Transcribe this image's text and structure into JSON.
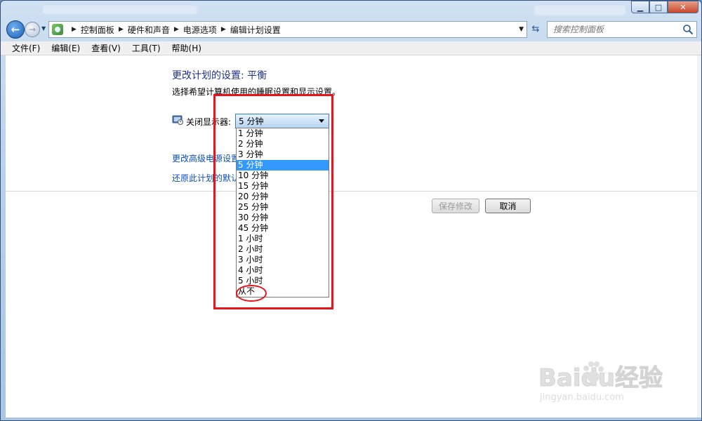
{
  "address_bar": {
    "crumbs": [
      "控制面板",
      "硬件和声音",
      "电源选项",
      "编辑计划设置"
    ]
  },
  "search": {
    "placeholder": "搜索控制面板"
  },
  "menu": [
    "文件(F)",
    "编辑(E)",
    "查看(V)",
    "工具(T)",
    "帮助(H)"
  ],
  "page": {
    "title": "更改计划的设置: 平衡",
    "description": "选择希望计算机使用的睡眠设置和显示设置。",
    "display_label": "关闭显示器:",
    "display_value": "5 分钟",
    "advanced_link": "更改高级电源设置(C)",
    "restore_link": "还原此计划的默认设置"
  },
  "dropdown": {
    "options": [
      "1 分钟",
      "2 分钟",
      "3 分钟",
      "5 分钟",
      "10 分钟",
      "15 分钟",
      "20 分钟",
      "25 分钟",
      "30 分钟",
      "45 分钟",
      "1 小时",
      "2 小时",
      "3 小时",
      "4 小时",
      "5 小时",
      "从不"
    ],
    "selected_index": 3
  },
  "buttons": {
    "save": "保存修改",
    "cancel": "取消"
  },
  "watermark": {
    "main": "Baidu经验",
    "sub": "jingyan.baidu.com"
  },
  "colors": {
    "accent_link": "#0b4fb3",
    "annotation": "#e8141b",
    "selection": "#3399ff"
  }
}
